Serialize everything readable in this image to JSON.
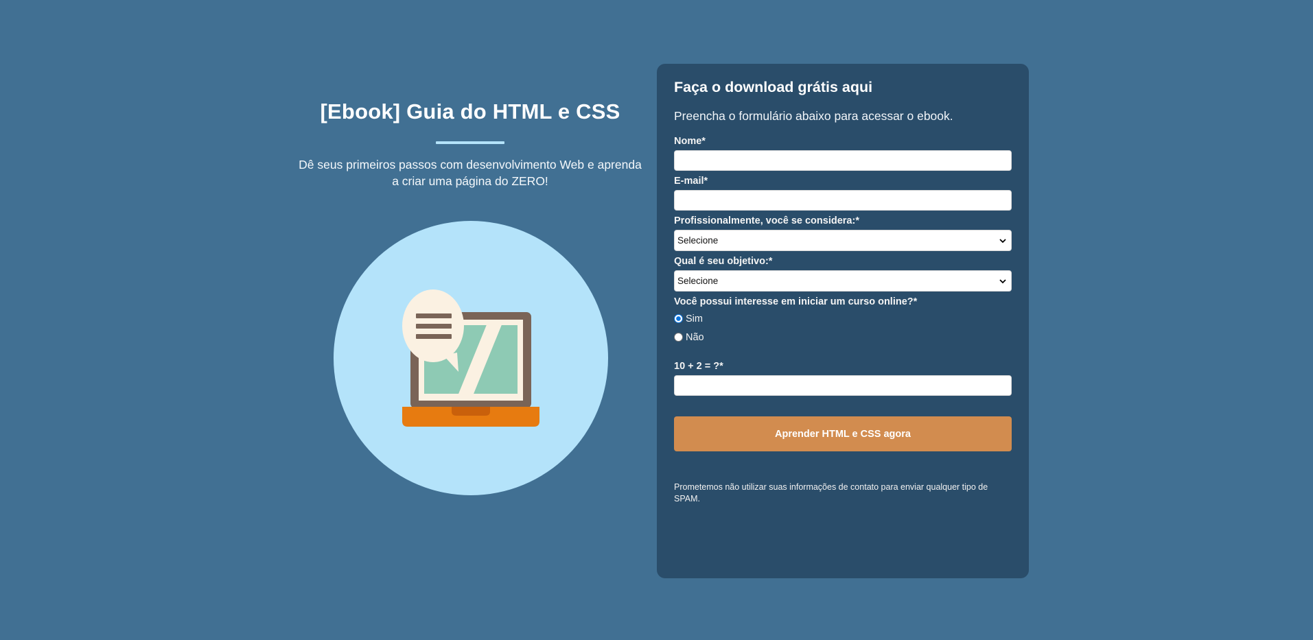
{
  "hero": {
    "title": "[Ebook] Guia do HTML e CSS",
    "subtitle": "Dê seus primeiros passos com desenvolvimento Web e aprenda a criar uma página do ZERO!"
  },
  "form": {
    "heading": "Faça o download grátis aqui",
    "lead": "Preencha o formulário abaixo para acessar o ebook.",
    "name_label": "Nome*",
    "name_value": "",
    "email_label": "E-mail*",
    "email_value": "",
    "profession_label": "Profissionalmente, você se considera:*",
    "profession_selected": "Selecione",
    "goal_label": "Qual é seu objetivo:*",
    "goal_selected": "Selecione",
    "course_question": "Você possui interesse em iniciar um curso online?*",
    "course_options": [
      {
        "label": "Sim",
        "checked": true
      },
      {
        "label": "Não",
        "checked": false
      }
    ],
    "captcha_label": "10 + 2 = ?*",
    "captcha_value": "",
    "submit_label": "Aprender HTML e CSS agora",
    "disclaimer": "Prometemos não utilizar suas informações de contato para enviar qualquer tipo de SPAM."
  },
  "colors": {
    "background": "#417093",
    "card": "#2a4d6a",
    "accent_divider": "#b4e3fa",
    "button": "#d28c4f",
    "circle": "#b4e3fa"
  }
}
